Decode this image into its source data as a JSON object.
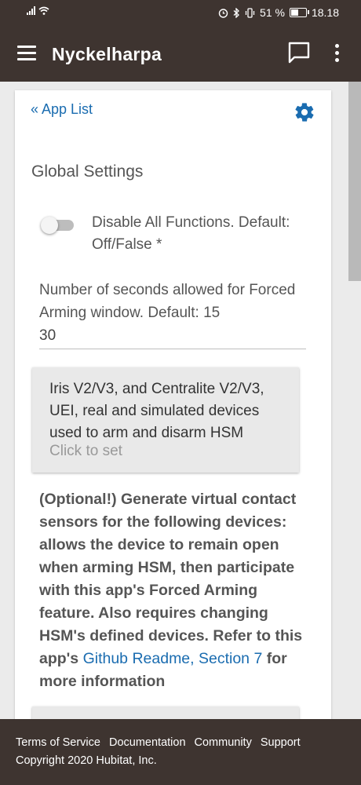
{
  "status_bar": {
    "battery_percent": "51 %",
    "time": "18.18",
    "battery_level": 0.51
  },
  "app_bar": {
    "title": "Nyckelharpa",
    "menu_icon": "hamburger-menu-icon",
    "chat_icon": "chat-bubble-icon",
    "more_icon": "more-vertical-icon"
  },
  "card": {
    "back_link": "« App List",
    "settings_icon": "gear-icon",
    "section_title": "Global Settings",
    "toggle": {
      "label": "Disable All Functions. Default: Off/False *",
      "state": "off"
    },
    "forced_arming": {
      "label": "Number of seconds allowed for Forced Arming window. Default: 15",
      "value": "30"
    },
    "device_selector": {
      "text": "Iris V2/V3, and Centralite V2/V3, UEI, real and simulated devices used to arm and disarm HSM",
      "hint": "Click to set"
    },
    "description": {
      "text_before_link": "(Optional!) Generate virtual contact sensors for the following devices: allows the device to remain open when arming HSM, then participate with this app's Forced Arming feature. Also requires changing HSM's defined devices. Refer to this app's ",
      "link_text": "Github Readme, Section 7",
      "text_after_link": " for more information"
    }
  },
  "footer": {
    "links": [
      "Terms of Service",
      "Documentation",
      "Community",
      "Support"
    ],
    "copyright": "Copyright 2020 Hubitat, Inc."
  },
  "colors": {
    "bar_background": "#3e3430",
    "link": "#1a6cb0",
    "card_background": "#ffffff",
    "page_background": "#ebebeb"
  }
}
